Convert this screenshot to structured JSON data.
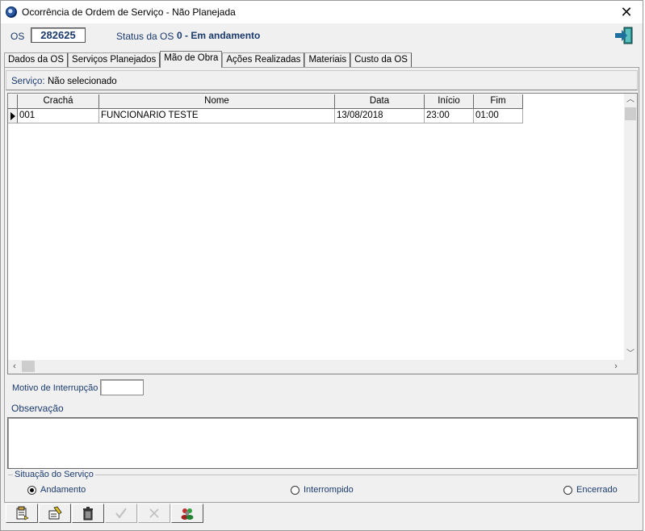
{
  "window": {
    "title": "Ocorrência de Ordem de Serviço - Não Planejada",
    "close_glyph": "✕"
  },
  "header": {
    "os_label": "OS",
    "os_number": "282625",
    "status_label": "Status da OS",
    "status_value": "0 - Em andamento",
    "exit_icon": "exit-door-icon"
  },
  "tabs": [
    {
      "label": "Dados da OS",
      "active": false
    },
    {
      "label": "Serviços Planejados",
      "active": false
    },
    {
      "label": "Mão de Obra",
      "active": true
    },
    {
      "label": "Ações Realizadas",
      "active": false
    },
    {
      "label": "Materiais",
      "active": false
    },
    {
      "label": "Custo da OS",
      "active": false
    }
  ],
  "servico": {
    "label": "Serviço:",
    "value": "Não selecionado"
  },
  "grid": {
    "columns": [
      "Crachá",
      "Nome",
      "Data",
      "Início",
      "Fim"
    ],
    "rows": [
      {
        "cracha": "001",
        "nome": "FUNCIONARIO TESTE",
        "data": "13/08/2018",
        "inicio": "23:00",
        "fim": "01:00"
      }
    ]
  },
  "motivo": {
    "label": "Motivo de Interrupção",
    "value": ""
  },
  "observacao": {
    "label": "Observação",
    "value": ""
  },
  "situacao": {
    "legend": "Situação do Serviço",
    "options": [
      {
        "label": "Andamento",
        "selected": true
      },
      {
        "label": "Interrompido",
        "selected": false
      },
      {
        "label": "Encerrado",
        "selected": false
      }
    ]
  },
  "toolbar": {
    "buttons": [
      {
        "icon": "new-document-icon",
        "enabled": true
      },
      {
        "icon": "edit-icon",
        "enabled": true
      },
      {
        "icon": "delete-trash-icon",
        "enabled": true
      },
      {
        "icon": "confirm-check-icon",
        "enabled": false
      },
      {
        "icon": "cancel-x-icon",
        "enabled": false
      },
      {
        "icon": "users-icon",
        "enabled": true
      }
    ]
  },
  "colors": {
    "label_blue": "#1a3a6e",
    "window_bg": "#f0f0f0"
  }
}
